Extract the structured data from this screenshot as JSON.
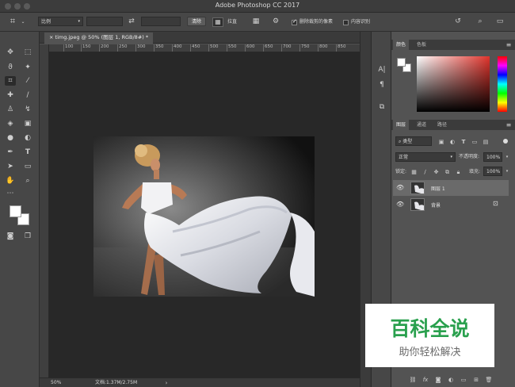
{
  "window": {
    "title": "Adobe Photoshop CC 2017"
  },
  "options": {
    "ratio_label": "比例",
    "clear_label": "清除",
    "straighten_label": "拉直",
    "delete_cropped_label": "删除裁剪的像素",
    "delete_cropped_checked": true,
    "content_aware_label": "内容识别",
    "content_aware_checked": false
  },
  "document": {
    "tab_title": "timg.jpeg @ 50% (图层 1, RGB/8#) *",
    "ruler_ticks": [
      "100",
      "150",
      "200",
      "250",
      "300",
      "350",
      "400",
      "450",
      "500",
      "550",
      "600",
      "650",
      "700",
      "750",
      "800",
      "850"
    ],
    "zoom": "50%",
    "doc_info": "文档:1.37M/2.75M"
  },
  "color_panel": {
    "tabs": [
      "颜色",
      "色板"
    ]
  },
  "layers_panel": {
    "tabs": [
      "图层",
      "通道",
      "路径"
    ],
    "filter_kind": "类型",
    "blend_mode": "正常",
    "opacity_label": "不透明度:",
    "opacity_value": "100%",
    "lock_label": "锁定:",
    "fill_label": "填充:",
    "fill_value": "100%",
    "layers": [
      {
        "name": "图层 1",
        "selected": true
      },
      {
        "name": "背景",
        "selected": false,
        "locked": true
      }
    ]
  },
  "watermark": {
    "title": "百科全说",
    "subtitle": "助你轻松解决"
  }
}
